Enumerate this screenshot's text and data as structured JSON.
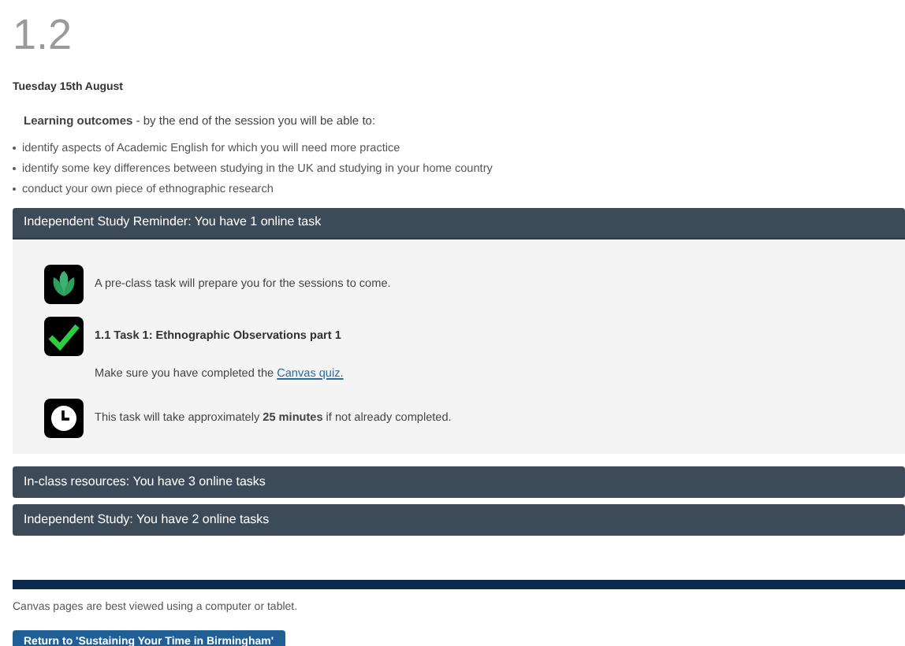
{
  "title": "1.2",
  "date": "Tuesday 15th August",
  "intro": "**Learning outcomes** - by the end of the session you will be able to:",
  "outcomes": [
    "identify aspects of Academic English for which you will need more practice",
    "identify some key differences between studying in the UK and studying in your home country",
    "conduct your own piece of ethnographic research"
  ],
  "sections": [
    {
      "title": "Independent Study Reminder: You have 1 online task",
      "expanded": true,
      "items": [
        {
          "kind": "leaf",
          "text": "A pre-class task will prepare you for the sessions to come."
        },
        {
          "kind": "check",
          "heading": "1.1 Task 1: Ethnographic Observations part 1",
          "note": "Make sure you have completed the",
          "link": "Canvas quiz."
        },
        {
          "kind": "clock",
          "text": "This task will take approximately **25 minutes** if not already completed."
        }
      ]
    },
    {
      "title": "In-class resources: You have 3 online tasks",
      "expanded": false
    },
    {
      "title": "Independent Study: You have 2 online tasks",
      "expanded": false
    }
  ],
  "footer": "Canvas pages are best viewed using a computer or tablet.",
  "return_button": "Return to 'Sustaining Your Time in Birmingham'"
}
